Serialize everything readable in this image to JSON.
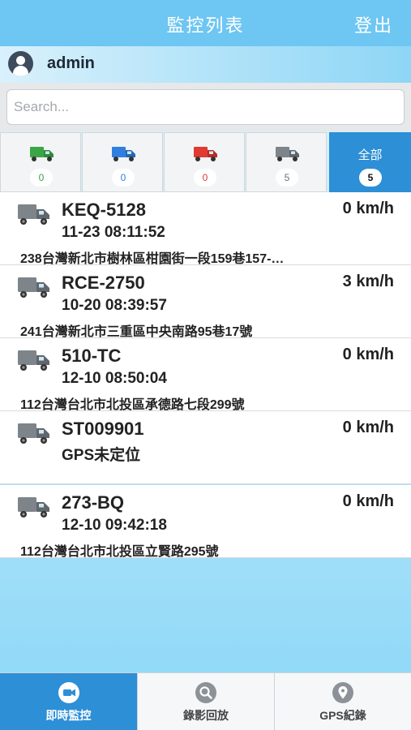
{
  "header": {
    "title": "監控列表",
    "logout_label": "登出"
  },
  "user": {
    "name": "admin",
    "icon": "user-avatar-icon"
  },
  "search": {
    "placeholder": "Search..."
  },
  "filters": [
    {
      "icon": "truck-green-icon",
      "color": "#3aa646",
      "count": "0"
    },
    {
      "icon": "truck-blue-icon",
      "color": "#2f7fe0",
      "count": "0"
    },
    {
      "icon": "truck-red-icon",
      "color": "#e03a33",
      "count": "0"
    },
    {
      "icon": "truck-gray-icon",
      "color": "#6b7279",
      "count": "5"
    },
    {
      "label": "全部",
      "count": "5",
      "active": true
    }
  ],
  "vehicles": [
    {
      "plate": "KEQ-5128",
      "speed": "0 km/h",
      "time": "11-23 08:11:52",
      "address": "238台灣新北市樹林區柑園街一段159巷157-…"
    },
    {
      "plate": "RCE-2750",
      "speed": "3 km/h",
      "time": "10-20 08:39:57",
      "address": "241台灣新北市三重區中央南路95巷17號"
    },
    {
      "plate": "510-TC",
      "speed": "0 km/h",
      "time": "12-10 08:50:04",
      "address": "112台灣台北市北投區承德路七段299號"
    },
    {
      "plate": "ST009901",
      "speed": "0 km/h",
      "time": "GPS未定位",
      "address": ""
    },
    {
      "plate": "273-BQ",
      "speed": "0 km/h",
      "time": "12-10 09:42:18",
      "address": "112台灣台北市北投區立賢路295號"
    }
  ],
  "tabs": [
    {
      "label": "即時監控",
      "icon": "video-camera-icon",
      "active": true
    },
    {
      "label": "錄影回放",
      "icon": "magnifier-icon"
    },
    {
      "label": "GPS紀錄",
      "icon": "map-pin-icon"
    }
  ],
  "colors": {
    "accent": "#2d8fd6",
    "header": "#6ec6f2",
    "truck_default": "#6b7279"
  }
}
